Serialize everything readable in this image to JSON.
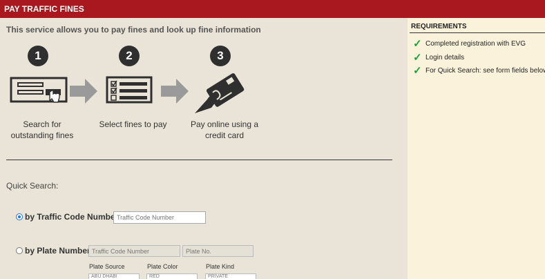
{
  "header": {
    "title": "PAY TRAFFIC FINES"
  },
  "intro": "This service allows you to pay fines and look up fine information",
  "steps": [
    {
      "number": "1",
      "label_line1": "Search for",
      "label_line2": "outstanding fines",
      "icon": "search-form-click-icon"
    },
    {
      "number": "2",
      "label_line1": "Select fines to pay",
      "label_line2": "",
      "icon": "checklist-icon"
    },
    {
      "number": "3",
      "label_line1": "Pay online using a",
      "label_line2": "credit card",
      "icon": "credit-card-hand-icon"
    }
  ],
  "quick_search": {
    "title": "Quick Search:",
    "by_traffic_code": {
      "label": "by Traffic Code Number",
      "selected": true,
      "placeholder": "Traffic Code Number"
    },
    "by_plate": {
      "label": "by Plate Number",
      "selected": false,
      "traffic_code_placeholder": "Traffic Code Number",
      "plate_no_placeholder": "Plate No.",
      "plate_source_label": "Plate Source",
      "plate_color_label": "Plate Color",
      "plate_kind_label": "Plate Kind",
      "plate_source_value": "ABU DHABI",
      "plate_color_value": "RED",
      "plate_kind_value": "PRIVATE"
    }
  },
  "requirements": {
    "title": "REQUIREMENTS",
    "items": [
      "Completed registration with EVG",
      "Login details",
      "For Quick Search: see form fields below"
    ]
  },
  "colors": {
    "header_bg": "#a8181e",
    "main_bg": "#e9e4d7",
    "side_bg": "#fbf2dc",
    "check": "#1aa33a"
  }
}
